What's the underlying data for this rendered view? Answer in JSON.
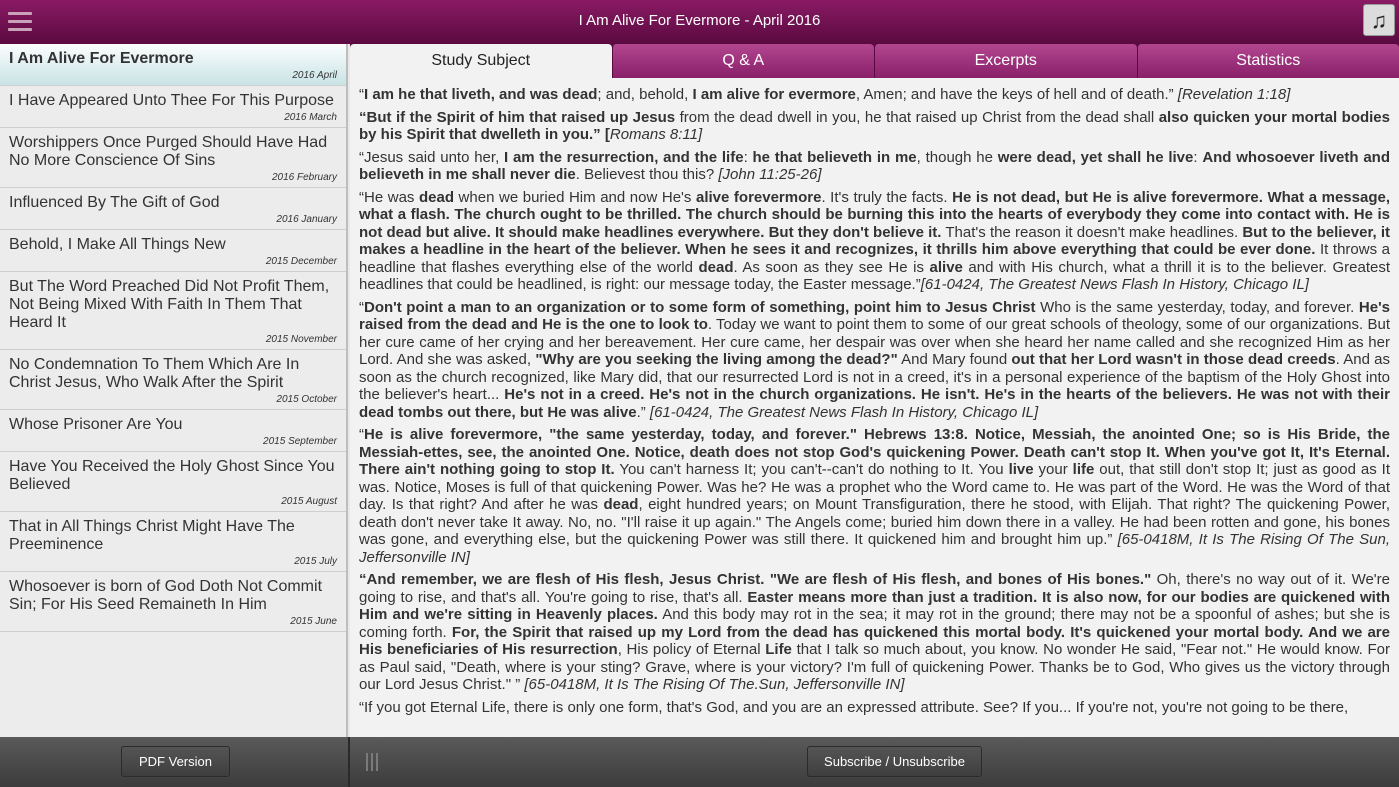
{
  "header": {
    "title": "I Am Alive For Evermore - April 2016",
    "menu_icon": "hamburger-icon",
    "music_icon": "music-note-icon",
    "music_glyph": "♫"
  },
  "sidebar": {
    "items": [
      {
        "label": "I Am Alive For Evermore",
        "date": "2016 April"
      },
      {
        "label": "I Have Appeared Unto Thee For This Purpose",
        "date": "2016 March"
      },
      {
        "label": "Worshippers Once Purged Should Have Had No More Conscience Of Sins",
        "date": "2016 February"
      },
      {
        "label": "Influenced By The Gift of God",
        "date": "2016 January"
      },
      {
        "label": "Behold, I Make All Things New",
        "date": "2015 December"
      },
      {
        "label": "But The Word Preached Did Not Profit Them, Not Being Mixed With Faith In Them That Heard It",
        "date": "2015 November"
      },
      {
        "label": "No Condemnation To Them Which Are In Christ Jesus, Who Walk After the Spirit",
        "date": "2015 October"
      },
      {
        "label": "Whose Prisoner Are You",
        "date": "2015 September"
      },
      {
        "label": "Have You Received the Holy Ghost Since You Believed",
        "date": "2015 August"
      },
      {
        "label": "That in All Things Christ Might Have The Preeminence",
        "date": "2015 July"
      },
      {
        "label": "Whosoever is born of God Doth Not Commit Sin; For His Seed Remaineth In Him",
        "date": "2015 June"
      }
    ]
  },
  "tabs": [
    "Study Subject",
    "Q & A",
    "Excerpts",
    "Statistics"
  ],
  "content": {
    "paragraphs": [
      [
        {
          "t": "“"
        },
        {
          "t": "I am he that liveth, and was dead",
          "b": true
        },
        {
          "t": "; and, behold, "
        },
        {
          "t": "I am alive for evermore",
          "b": true
        },
        {
          "t": ", Amen; and have the keys of hell and of death.” "
        },
        {
          "t": "[Revelation 1:18]",
          "i": true
        }
      ],
      [
        {
          "t": "“But if the Spirit of him that raised up Jesus",
          "b": true
        },
        {
          "t": " from the dead dwell in you, he that raised up Christ from the dead shall "
        },
        {
          "t": "also quicken your mortal bodies by his Spirit that dwelleth in you.” [",
          "b": true
        },
        {
          "t": "Romans 8:11]",
          "i": true
        }
      ],
      [
        {
          "t": "“Jesus said unto her, "
        },
        {
          "t": "I am the resurrection, and the life",
          "b": true
        },
        {
          "t": ": "
        },
        {
          "t": "he that believeth in me",
          "b": true
        },
        {
          "t": ", though he "
        },
        {
          "t": "were dead, yet shall he live",
          "b": true
        },
        {
          "t": ": "
        },
        {
          "t": "And whosoever liveth and believeth in me shall never die",
          "b": true
        },
        {
          "t": ". Believest thou this? "
        },
        {
          "t": "[John 11:25-26]",
          "i": true
        }
      ],
      [
        {
          "t": "“He was "
        },
        {
          "t": "dead",
          "b": true
        },
        {
          "t": " when we buried Him and now He's "
        },
        {
          "t": "alive forevermore",
          "b": true
        },
        {
          "t": ". It's truly the facts. "
        },
        {
          "t": "He is not dead, but He is alive forevermore. What a message, what a flash. The church ought to be thrilled. The church should be burning this into the hearts of everybody they come into contact with. He is not dead but alive. It should make headlines everywhere. But they don't believe it.",
          "b": true
        },
        {
          "t": " That's the reason it doesn't make headlines. "
        },
        {
          "t": "But to the believer, it makes a headline in the heart of the believer. When he sees it and recognizes, it thrills him above everything that could be ever done.",
          "b": true
        },
        {
          "t": " It throws a headline that flashes everything else of the world "
        },
        {
          "t": "dead",
          "b": true
        },
        {
          "t": ". As soon as they see He is "
        },
        {
          "t": "alive",
          "b": true
        },
        {
          "t": " and with His church, what a thrill it is to the believer. Greatest headlines that could be headlined, is right: our message today, the Easter message.”"
        },
        {
          "t": "[61-0424, The Greatest News Flash In History, Chicago IL]",
          "i": true
        }
      ],
      [
        {
          "t": "“"
        },
        {
          "t": "Don't point a man to an organization or to some form of something, point him to Jesus Christ",
          "b": true
        },
        {
          "t": " Who is the same yesterday, today, and forever. "
        },
        {
          "t": "He's raised from the dead and He is the one to look to",
          "b": true
        },
        {
          "t": ". Today we want to point them to some of our great schools of theology, some of our organizations. But her cure came of her crying and her bereavement. Her cure came, her despair was over when she heard her name called and she recognized Him as her Lord. And she was asked, "
        },
        {
          "t": "\"Why are you seeking the living among the dead?\"",
          "b": true
        },
        {
          "t": " And Mary found "
        },
        {
          "t": "out that her Lord wasn't in those dead creeds",
          "b": true
        },
        {
          "t": ". And as soon as the church recognized, like Mary did, that our resurrected Lord is not in a creed, it's in a personal experience of the baptism of the Holy Ghost into the believer's heart... "
        },
        {
          "t": "He's not in a creed. He's not in the church organizations. He isn't. He's in the hearts of the believers. He was not with their dead tombs out there, but He was alive",
          "b": true
        },
        {
          "t": ".” "
        },
        {
          "t": "[61-0424, The Greatest News Flash In History, Chicago IL]",
          "i": true
        }
      ],
      [
        {
          "t": "“"
        },
        {
          "t": "He is alive forevermore, \"the same yesterday, today, and forever.\" Hebrews 13:8. Notice, Messiah, the anointed One; so is His Bride, the Messiah-ettes, see, the anointed One. Notice, death does not stop God's quickening Power. Death can't stop It. When you've got It, It's Eternal. There ain't nothing going to stop It.",
          "b": true
        },
        {
          "t": " You can't harness It; you can't--can't do nothing to It. You "
        },
        {
          "t": "live",
          "b": true
        },
        {
          "t": " your "
        },
        {
          "t": "life",
          "b": true
        },
        {
          "t": " out, that still don't stop It; just as good as It was. Notice, Moses is full of that quickening Power. Was he? He was a prophet who the Word came to. He was part of the Word. He was the Word of that day. Is that right? And after he was "
        },
        {
          "t": "dead",
          "b": true
        },
        {
          "t": ", eight hundred years; on Mount Transfiguration, there he stood, with Elijah. That right? The quickening Power, death don't never take It away. No, no. \"I'll raise it up again.\" The Angels come; buried him down there in a valley. He had been rotten and gone, his bones was gone, and everything else, but the quickening Power was still there. It quickened him and brought him up.” "
        },
        {
          "t": "[65-0418M, It Is The Rising Of The Sun, Jeffersonville IN]",
          "i": true
        }
      ],
      [
        {
          "t": "“And remember, we are flesh of His flesh, Jesus Christ. \"We are flesh of His flesh, and bones of His bones.\"",
          "b": true
        },
        {
          "t": " Oh, there's no way out of it. We're going to rise, and that's all. You're going to rise, that's all. "
        },
        {
          "t": "Easter means more than just a tradition. It is also now, for our bodies are quickened with Him and we're sitting in Heavenly places.",
          "b": true
        },
        {
          "t": " And this body may rot in the sea; it may rot in the ground; there may not be a spoonful of ashes; but she is coming forth. "
        },
        {
          "t": "For, the Spirit that raised up my Lord from the dead has quickened this mortal body. It's quickened your mortal body. And we are His beneficiaries of His resurrection",
          "b": true
        },
        {
          "t": ", His policy of Eternal "
        },
        {
          "t": "Life",
          "b": true
        },
        {
          "t": " that I talk so much about, you know. No wonder He said, \"Fear not.\" He would know.  For as Paul said, \"Death, where is your sting? Grave, where is your victory? I'm full of quickening Power. Thanks be to God, Who gives us the victory through our Lord Jesus Christ.\" ” "
        },
        {
          "t": "[65-0418M, It Is The Rising Of The.Sun, Jeffersonville IN]",
          "i": true
        }
      ],
      [
        {
          "t": "“If you got Eternal Life, there is only one form, that's God, and you are an expressed attribute. See? If you... If you're not, you're not going to be there,"
        }
      ]
    ]
  },
  "footer": {
    "pdf_label": "PDF Version",
    "subscribe_label": "Subscribe / Unsubscribe",
    "grip_icon": "drag-handle-icon"
  }
}
